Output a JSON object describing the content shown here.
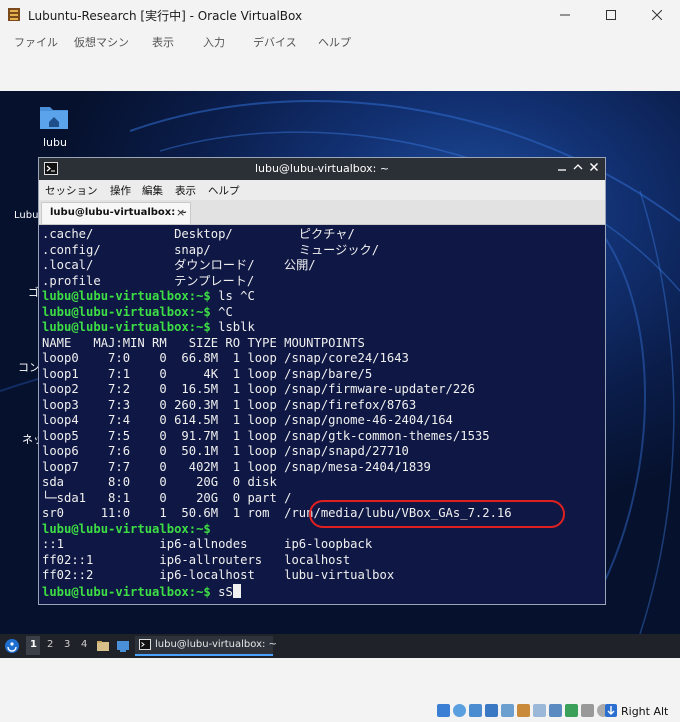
{
  "host_window": {
    "title": "Lubuntu-Research [実行中] - Oracle VirtualBox",
    "menu": [
      "ファイル",
      "仮想マシン",
      "表示",
      "入力",
      "デバイス",
      "ヘルプ"
    ]
  },
  "desktop": {
    "icons": [
      {
        "label": "lubu",
        "icon": "home-folder-icon"
      }
    ],
    "partial_labels": [
      "Lubu",
      "ゴ",
      "コン",
      "ネッ"
    ]
  },
  "terminal": {
    "title": "lubu@lubu-virtualbox: ~",
    "menu": [
      "セッション",
      "操作",
      "編集",
      "表示",
      "ヘルプ"
    ],
    "tab_label": "lubu@lubu-virtualbox: ~",
    "tab_close": "×",
    "prompt": "lubu@lubu-virtualbox:~$",
    "lines": [
      {
        "text": ".cache/           Desktop/         ピクチャ/"
      },
      {
        "text": ".config/          snap/            ミュージック/"
      },
      {
        "text": ".local/           ダウンロード/    公開/"
      },
      {
        "text": ".profile          テンプレート/"
      },
      {
        "prompt": true,
        "text": " ls ^C"
      },
      {
        "prompt": true,
        "text": " ^C"
      },
      {
        "prompt": true,
        "text": " lsblk"
      },
      {
        "text": "NAME   MAJ:MIN RM   SIZE RO TYPE MOUNTPOINTS"
      },
      {
        "text": "loop0    7:0    0  66.8M  1 loop /snap/core24/1643"
      },
      {
        "text": "loop1    7:1    0     4K  1 loop /snap/bare/5"
      },
      {
        "text": "loop2    7:2    0  16.5M  1 loop /snap/firmware-updater/226"
      },
      {
        "text": "loop3    7:3    0 260.3M  1 loop /snap/firefox/8763"
      },
      {
        "text": "loop4    7:4    0 614.5M  1 loop /snap/gnome-46-2404/164"
      },
      {
        "text": "loop5    7:5    0  91.7M  1 loop /snap/gtk-common-themes/1535"
      },
      {
        "text": "loop6    7:6    0  50.1M  1 loop /snap/snapd/27710"
      },
      {
        "text": "loop7    7:7    0   402M  1 loop /snap/mesa-2404/1839"
      },
      {
        "text": "sda      8:0    0    20G  0 disk"
      },
      {
        "text": "└─sda1   8:1    0    20G  0 part /"
      },
      {
        "text": "sr0     11:0    1  50.6M  1 rom  /run/media/lubu/VBox_GAs_7.2.16"
      },
      {
        "prompt": true,
        "text": ""
      },
      {
        "text": "::1             ip6-allnodes     ip6-loopback"
      },
      {
        "text": "ff02::1         ip6-allrouters   localhost"
      },
      {
        "text": "ff02::2         ip6-localhost    lubu-virtualbox"
      },
      {
        "prompt": true,
        "text": " sS",
        "cursor": true
      }
    ]
  },
  "taskbar": {
    "workspaces": [
      "1",
      "2",
      "3",
      "4"
    ],
    "active_workspace": "1",
    "task_label": "lubu@lubu-virtualbox: ~"
  },
  "statusbar": {
    "host_key": "Right Alt"
  },
  "colors": {
    "prompt": "#3dde44",
    "terminal_bg": "#0f1844",
    "annotation": "#e02020"
  }
}
